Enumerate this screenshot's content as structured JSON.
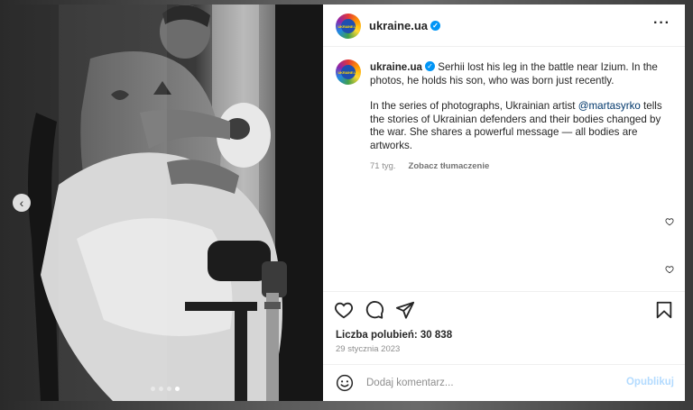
{
  "post": {
    "username": "ukraine.ua",
    "avatar_text": "UKRAINE.UA",
    "caption_line1": " Serhii lost his leg in the battle near Izium. In the photos, he holds his son, who was born just recently.",
    "caption_p2_before": "In the series of photographs, Ukrainian artist ",
    "caption_mention": "@martasyrko",
    "caption_p2_after": " tells the stories of Ukrainian defenders and their bodies changed by the war. She shares a powerful message — all bodies are artworks.",
    "age": "71 tyg.",
    "translate_label": "Zobacz tłumaczenie",
    "likes": "Liczba polubień: 30 838",
    "date": "29 stycznia 2023"
  },
  "composer": {
    "placeholder": "Dodaj komentarz...",
    "publish_label": "Opublikuj"
  },
  "carousel": {
    "slide_count": 4,
    "active_index": 3
  },
  "colors": {
    "verified": "#0095f6",
    "mention": "#00376b",
    "publish_disabled": "#b3dbff"
  },
  "icons": {
    "more": "more-options-icon",
    "like": "heart-icon",
    "comment": "comment-icon",
    "share": "paper-plane-icon",
    "save": "bookmark-icon",
    "emoji": "emoji-icon",
    "prev": "chevron-left-icon"
  }
}
